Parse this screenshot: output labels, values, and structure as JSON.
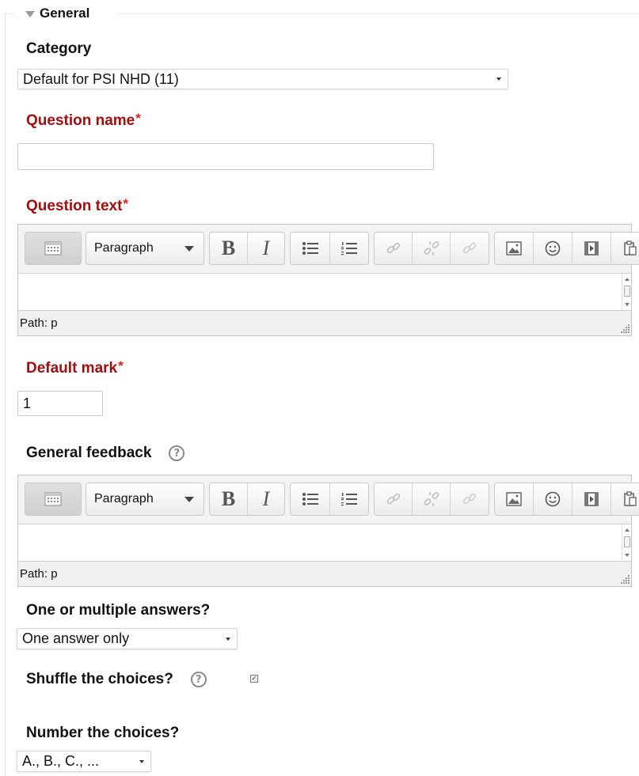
{
  "legend": {
    "title": "General"
  },
  "category": {
    "label": "Category",
    "selected": "Default for PSI NHD (11)"
  },
  "question_name": {
    "label": "Question name",
    "required_mark": "*",
    "value": ""
  },
  "question_text": {
    "label": "Question text",
    "required_mark": "*",
    "editor": {
      "format": "Paragraph",
      "bold": "B",
      "italic": "I",
      "content": "",
      "path": "Path: p"
    }
  },
  "default_mark": {
    "label": "Default mark",
    "required_mark": "*",
    "value": "1"
  },
  "general_feedback": {
    "label": "General feedback",
    "help": "?",
    "editor": {
      "format": "Paragraph",
      "bold": "B",
      "italic": "I",
      "content": "",
      "path": "Path: p"
    }
  },
  "single": {
    "label": "One or multiple answers?",
    "selected": "One answer only"
  },
  "shuffle": {
    "label": "Shuffle the choices?",
    "help": "?",
    "checked": true,
    "check_glyph": "✓"
  },
  "numbering": {
    "label": "Number the choices?",
    "selected": "A., B., C., ..."
  },
  "colors": {
    "required_label": "#a30d0d",
    "required_star": "#e21d1d",
    "fieldset_border": "#e3e3e3"
  },
  "icons": [
    "collapse-triangle-icon",
    "toolbar-toggle-icon",
    "unordered-list-icon",
    "ordered-list-icon",
    "link-icon",
    "unlink-icon",
    "anchor-icon",
    "image-icon",
    "emoticon-icon",
    "media-icon",
    "paste-icon",
    "help-icon",
    "resize-grip-icon"
  ]
}
